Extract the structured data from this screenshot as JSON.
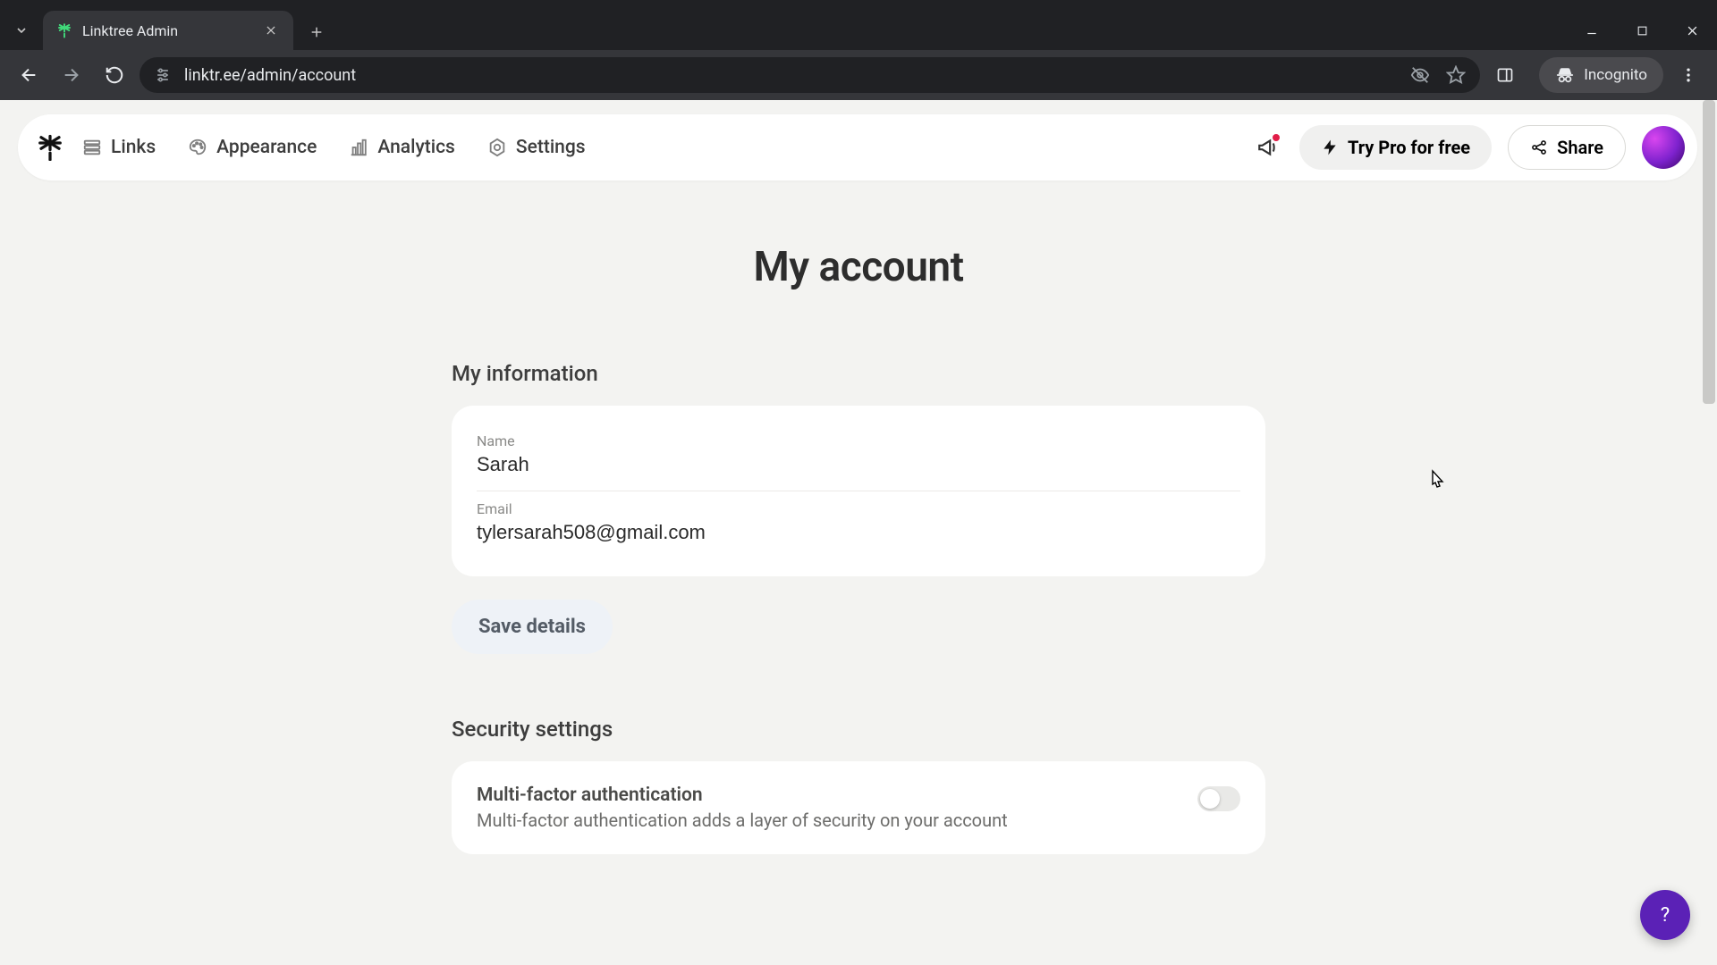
{
  "browser": {
    "tab_title": "Linktree Admin",
    "url": "linktr.ee/admin/account",
    "incognito_label": "Incognito"
  },
  "header": {
    "nav": {
      "links": "Links",
      "appearance": "Appearance",
      "analytics": "Analytics",
      "settings": "Settings"
    },
    "try_pro": "Try Pro for free",
    "share": "Share"
  },
  "page": {
    "title": "My account"
  },
  "info": {
    "section_title": "My information",
    "name_label": "Name",
    "name_value": "Sarah",
    "email_label": "Email",
    "email_value": "tylersarah508@gmail.com",
    "save_label": "Save details"
  },
  "security": {
    "section_title": "Security settings",
    "mfa_title": "Multi-factor authentication",
    "mfa_desc": "Multi-factor authentication adds a layer of security on your account"
  },
  "help": {
    "label": "?"
  }
}
